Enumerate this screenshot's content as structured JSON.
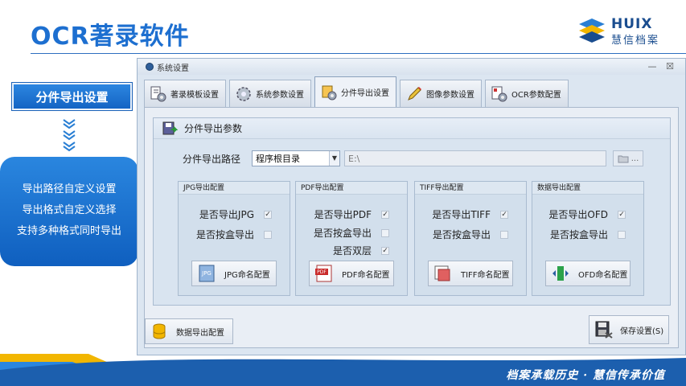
{
  "slide": {
    "title": "OCR著录软件",
    "logo_en": "HUIX",
    "logo_cn": "慧信档案",
    "footer_slogan": "档案承载历史 · 慧信传承价值"
  },
  "left_panel": {
    "badge": "分件导出设置",
    "features": [
      "导出路径自定义设置",
      "导出格式自定义选择",
      "支持多种格式同时导出"
    ]
  },
  "window": {
    "title": "系统设置",
    "minimize": "—",
    "close": "☒",
    "tabs": [
      {
        "label": "著录模板设置"
      },
      {
        "label": "系统参数设置"
      },
      {
        "label": "分件导出设置",
        "active": true
      },
      {
        "label": "图像参数设置"
      },
      {
        "label": "OCR参数配置"
      }
    ]
  },
  "export_params": {
    "group_title": "分件导出参数",
    "path_label": "分件导出路径",
    "path_mode": "程序根目录",
    "path_value": "E:\\",
    "browse_label": "..."
  },
  "configs": {
    "jpg": {
      "title": "JPG导出配置",
      "opt1": "是否导出JPG",
      "opt1_checked": "✓",
      "opt2": "是否按盒导出",
      "opt2_checked": "",
      "button": "JPG命名配置"
    },
    "pdf": {
      "title": "PDF导出配置",
      "opt1": "是否导出PDF",
      "opt1_checked": "✓",
      "opt2": "是否按盒导出",
      "opt2_checked": "",
      "opt3": "是否双层",
      "opt3_checked": "✓",
      "button": "PDF命名配置"
    },
    "tiff": {
      "title": "TIFF导出配置",
      "opt1": "是否导出TIFF",
      "opt1_checked": "✓",
      "opt2": "是否按盒导出",
      "opt2_checked": "",
      "button": "TIFF命名配置"
    },
    "data": {
      "title": "数据导出配置",
      "opt1": "是否导出OFD",
      "opt1_checked": "✓",
      "opt2": "是否按盒导出",
      "opt2_checked": "",
      "button": "OFD命名配置"
    }
  },
  "bottom": {
    "data_export": "数据导出配置",
    "save": "保存设置(S)"
  },
  "colors": {
    "brand_blue": "#1d6fd0",
    "accent_yellow": "#f2b600",
    "footer_blue": "#1c5fae"
  }
}
